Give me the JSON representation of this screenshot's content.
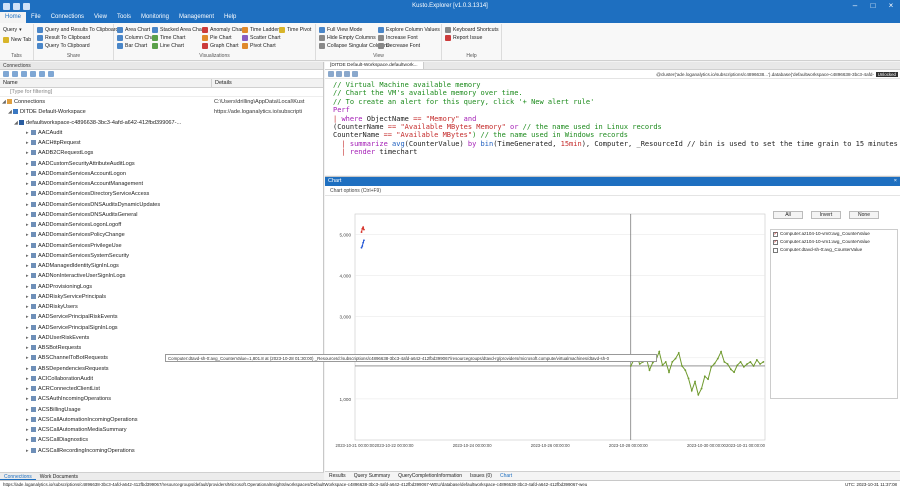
{
  "window": {
    "title": "Kusto.Explorer [v1.0.3.1314]"
  },
  "menu": {
    "tabs": [
      "Home",
      "File",
      "Connections",
      "View",
      "Tools",
      "Monitoring",
      "Management",
      "Help"
    ]
  },
  "ribbon": {
    "groups": [
      {
        "label": "Tabs",
        "items": [
          "Query",
          "New Tab"
        ]
      },
      {
        "label": "Share",
        "items": [
          "Query and Results To Clipboard",
          "Result To Clipboard",
          "Query To Clipboard"
        ]
      },
      {
        "label": "Visualizations",
        "items": [
          "Area Chart",
          "Stacked Area Chart",
          "Anomaly Chart",
          "Time Ladder",
          "Time Pivot",
          "Column Chart",
          "Time Chart",
          "Pie Chart",
          "Scatter Chart",
          "Bar Chart",
          "Line Chart",
          "Graph Chart",
          "Pivot Chart"
        ]
      },
      {
        "label": "View",
        "items": [
          "Full View Mode",
          "Explore Column Values",
          "Hide Empty Columns",
          "Increase Font",
          "Collapse Singular Columns",
          "Decrease Font"
        ]
      },
      {
        "label": "Help",
        "items": [
          "Keyboard Shortcuts",
          "Report Issue"
        ]
      }
    ]
  },
  "connections_panel": {
    "header": "Connections",
    "col_name": "Name",
    "col_details": "Details",
    "filter_placeholder": "[Type for filtering]",
    "root": {
      "name": "Connections",
      "details": "C:\\Users\\drilling\\AppData\\Local\\Kust"
    },
    "workspace": {
      "name": "DITDE Default-Workspace",
      "details": "https://ade.loganalytics.io/subscripti"
    },
    "database": {
      "name": "defaultworkspace-c4896638-3bc3-4afd-a642-412fbd399067-..."
    },
    "tables": [
      "AACAudit",
      "AACHttpRequest",
      "AADB2CRequestLogs",
      "AADCustomSecurityAttributeAuditLogs",
      "AADDomainServicesAccountLogon",
      "AADDomainServicesAccountManagement",
      "AADDomainServicesDirectoryServiceAccess",
      "AADDomainServicesDNSAuditsDynamicUpdates",
      "AADDomainServicesDNSAuditsGeneral",
      "AADDomainServicesLogonLogoff",
      "AADDomainServicesPolicyChange",
      "AADDomainServicesPrivilegeUse",
      "AADDomainServicesSystemSecurity",
      "AADManagedIdentitySignInLogs",
      "AADNonInteractiveUserSignInLogs",
      "AADProvisioningLogs",
      "AADRiskyServicePrincipals",
      "AADRiskyUsers",
      "AADServicePrincipalRiskEvents",
      "AADServicePrincipalSignInLogs",
      "AADUserRiskEvents",
      "ABSBotRequests",
      "ABSChannelToBotRequests",
      "ABSDependenciesRequests",
      "ACICollaborationAudit",
      "ACRConnectedClientList",
      "ACSAuthIncomingOperations",
      "ACSBillingUsage",
      "ACSCallAutomationIncomingOperations",
      "ACSCallAutomationMediaSummary",
      "ACSCallDiagnostics",
      "ACSCallRecordingIncomingOperations"
    ],
    "bottom_tabs": [
      "Connections",
      "Work Documents"
    ]
  },
  "editor": {
    "tab_title": "[DITDE Default-Workspace.defaultwork...",
    "connection": "@cluster('ade.loganalytics.io/subscriptions/c4896638...').database('defaultworkspace-c4896638-3bc3-4afd-",
    "badge": "Unlocked",
    "code": {
      "l1": "// Virtual Machine available memory",
      "l2": "// Chart the VM's available memory over time.",
      "l3": "// To create an alert for this query, click '+ New alert rule'",
      "l4": "Perf",
      "l5_pipe": "| ",
      "l5_kw": "where",
      "l5_a": " ObjectName ",
      "l5_op": "==",
      "l5_s": " \"Memory\"",
      "l5_and": " and",
      "l6_a": "(CounterName ",
      "l6_op": "==",
      "l6_s": " \"Available MBytes Memory\"",
      "l6_or": " or",
      "l6_c": " // the name used in Linux records",
      "l7_a": "CounterName ",
      "l7_op": "==",
      "l7_s": " \"Available MBytes\"",
      "l7_c": ") // the name used in Windows records",
      "l8_pipe": "| ",
      "l8_kw": "summarize",
      "l8_fn": " avg",
      "l8_a": "(CounterValue) ",
      "l8_by": "by",
      "l8_fn2": " bin",
      "l8_b": "(TimeGenerated, ",
      "l8_n": "15min",
      "l8_c": "), Computer, _ResourceId // bin is used to set the time grain to 15 minutes",
      "l9_pipe": "| ",
      "l9_kw": "render",
      "l9_a": " timechart"
    }
  },
  "chart_panel": {
    "header": "Chart",
    "options_label": "Chart options (Ctrl+F9)",
    "buttons": [
      "All",
      "Invert",
      "None"
    ],
    "legend": [
      {
        "name": "Computer:az104-10-vm0:avg_CounterValue",
        "checked": true,
        "color": "#2456d6"
      },
      {
        "name": "Computer:az104-10-vm1:avg_CounterValue",
        "checked": true,
        "color": "#d6322a"
      },
      {
        "name": "Computer:dtavd-sh-0:avg_CounterValue",
        "checked": false,
        "color": "#6f9a2e"
      }
    ],
    "tooltip": "Computer:dtavd-sh-0:avg_CounterValue=1,801.8 at (2023-10-28 01:30:00) _ResourceId:/subscriptions/c4896638-3bc3-4afd-a642-412fbd399067/resourcegroups/dtavd-rg/providers/microsoft.compute/virtualmachines/dtavd-sh-0",
    "bottom_tabs": [
      "Results",
      "Query Summary",
      "QueryCompletionInformation",
      "Issues (0)",
      "Chart"
    ]
  },
  "chart_data": {
    "type": "line",
    "ylim": [
      0,
      5500
    ],
    "yticks": [
      1000,
      2000,
      3000,
      4000,
      5000
    ],
    "ytick_labels": [
      "1,000",
      "2,000",
      "3,000",
      "4,000",
      "5,000"
    ],
    "x_range": [
      "2023-10-21 00:00:00",
      "2023-10-31 12:00:00"
    ],
    "xtick_labels": [
      "2023-10-21 00:00:00",
      "2023-10-22 00:00:00",
      "2023-10-24 00:00:00",
      "2023-10-26 00:00:00",
      "2023-10-28 00:00:00",
      "2023-10-30 00:00:00",
      "2023-10-31 00:00:00"
    ],
    "xtick_values": [
      "2023-10-21 00:00:00",
      "2023-10-22 00:00:00",
      "2023-10-24 00:00:00",
      "2023-10-26 00:00:00",
      "2023-10-28 00:00:00",
      "2023-10-30 00:00:00",
      "2023-10-31 00:00:00"
    ],
    "crosshair": {
      "x": "2023-10-28 01:30:00",
      "y": 1801.8
    },
    "series": [
      {
        "name": "Computer:az104-10-vm0:avg_CounterValue",
        "color": "#2456d6",
        "points": [
          [
            "2023-10-21 04:00:00",
            4680
          ],
          [
            "2023-10-21 04:30:00",
            4720
          ],
          [
            "2023-10-21 05:00:00",
            4800
          ],
          [
            "2023-10-21 05:30:00",
            4860
          ]
        ]
      },
      {
        "name": "Computer:az104-10-vm1:avg_CounterValue",
        "color": "#d6322a",
        "points": [
          [
            "2023-10-21 04:00:00",
            5060
          ],
          [
            "2023-10-21 04:30:00",
            5140
          ],
          [
            "2023-10-21 05:00:00",
            5180
          ],
          [
            "2023-10-21 05:30:00",
            5120
          ]
        ]
      },
      {
        "name": "Computer:dtavd-sh-0:avg_CounterValue",
        "color": "#6f9a2e",
        "points": [
          [
            "2023-10-28 01:30:00",
            1801.8
          ],
          [
            "2023-10-28 03:00:00",
            1920
          ],
          [
            "2023-10-28 05:00:00",
            2050
          ],
          [
            "2023-10-28 07:00:00",
            1850
          ],
          [
            "2023-10-28 09:00:00",
            1900
          ],
          [
            "2023-10-28 11:00:00",
            2000
          ],
          [
            "2023-10-28 13:00:00",
            1700
          ],
          [
            "2023-10-28 15:00:00",
            1880
          ],
          [
            "2023-10-28 17:00:00",
            1950
          ],
          [
            "2023-10-28 19:00:00",
            2150
          ],
          [
            "2023-10-28 21:00:00",
            1820
          ],
          [
            "2023-10-28 23:00:00",
            1900
          ],
          [
            "2023-10-29 01:00:00",
            1650
          ],
          [
            "2023-10-29 03:00:00",
            1900
          ],
          [
            "2023-10-29 05:00:00",
            1980
          ],
          [
            "2023-10-29 07:00:00",
            2120
          ],
          [
            "2023-10-29 09:00:00",
            1800
          ],
          [
            "2023-10-29 11:00:00",
            1700
          ],
          [
            "2023-10-29 13:00:00",
            1500
          ],
          [
            "2023-10-29 15:00:00",
            1200
          ],
          [
            "2023-10-29 17:00:00",
            1420
          ],
          [
            "2023-10-29 19:00:00",
            1100
          ],
          [
            "2023-10-29 21:00:00",
            1250
          ],
          [
            "2023-10-29 23:00:00",
            1550
          ],
          [
            "2023-10-30 01:00:00",
            1480
          ],
          [
            "2023-10-30 03:00:00",
            1780
          ],
          [
            "2023-10-30 05:00:00",
            1860
          ],
          [
            "2023-10-30 07:00:00",
            1980
          ],
          [
            "2023-10-30 09:00:00",
            2150
          ],
          [
            "2023-10-30 11:00:00",
            1900
          ],
          [
            "2023-10-30 13:00:00",
            1850
          ],
          [
            "2023-10-30 15:00:00",
            1720
          ],
          [
            "2023-10-30 17:00:00",
            1650
          ],
          [
            "2023-10-30 19:00:00",
            1820
          ],
          [
            "2023-10-30 21:00:00",
            1900
          ],
          [
            "2023-10-30 23:00:00",
            1780
          ],
          [
            "2023-10-31 01:00:00",
            1850
          ],
          [
            "2023-10-31 03:00:00",
            1900
          ],
          [
            "2023-10-31 05:00:00",
            1800
          ],
          [
            "2023-10-31 07:00:00",
            1950
          ],
          [
            "2023-10-31 09:00:00",
            1850
          ],
          [
            "2023-10-31 11:00:00",
            1900
          ]
        ]
      }
    ]
  },
  "statusbar": {
    "left": "https://ade.loganalytics.io/subscriptions/c4896638-3bc3-4afd-a642-412fbd399067/resourcegroups/default/providers/Microsoft.OperationalInsights/workspaces/DefaultWorkspace-c4896638-3bc3-4afd-a642-412fbd399067-WEU/database/defaultworkspace-c4896638-3bc3-4afd-a642-412fbd399067-weu",
    "right": "UTC: 2023-10-31 11:37:08"
  }
}
